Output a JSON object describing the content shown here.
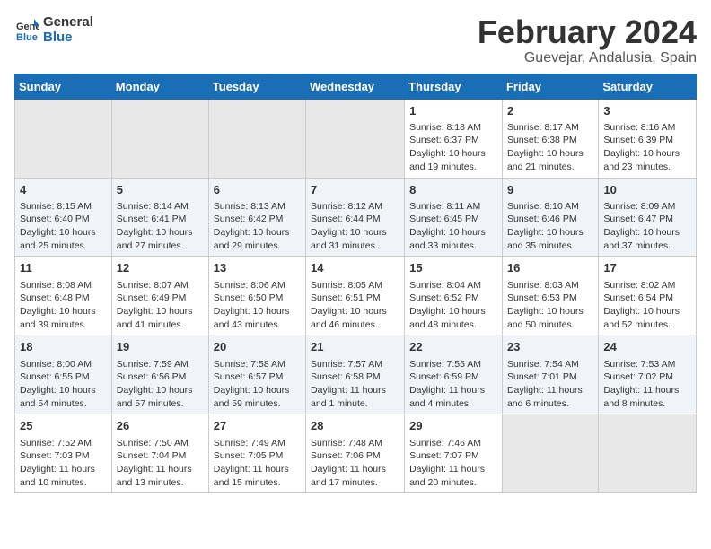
{
  "logo": {
    "line1": "General",
    "line2": "Blue"
  },
  "title": "February 2024",
  "subtitle": "Guevejar, Andalusia, Spain",
  "weekdays": [
    "Sunday",
    "Monday",
    "Tuesday",
    "Wednesday",
    "Thursday",
    "Friday",
    "Saturday"
  ],
  "weeks": [
    [
      {
        "day": "",
        "content": ""
      },
      {
        "day": "",
        "content": ""
      },
      {
        "day": "",
        "content": ""
      },
      {
        "day": "",
        "content": ""
      },
      {
        "day": "1",
        "content": "Sunrise: 8:18 AM\nSunset: 6:37 PM\nDaylight: 10 hours and 19 minutes."
      },
      {
        "day": "2",
        "content": "Sunrise: 8:17 AM\nSunset: 6:38 PM\nDaylight: 10 hours and 21 minutes."
      },
      {
        "day": "3",
        "content": "Sunrise: 8:16 AM\nSunset: 6:39 PM\nDaylight: 10 hours and 23 minutes."
      }
    ],
    [
      {
        "day": "4",
        "content": "Sunrise: 8:15 AM\nSunset: 6:40 PM\nDaylight: 10 hours and 25 minutes."
      },
      {
        "day": "5",
        "content": "Sunrise: 8:14 AM\nSunset: 6:41 PM\nDaylight: 10 hours and 27 minutes."
      },
      {
        "day": "6",
        "content": "Sunrise: 8:13 AM\nSunset: 6:42 PM\nDaylight: 10 hours and 29 minutes."
      },
      {
        "day": "7",
        "content": "Sunrise: 8:12 AM\nSunset: 6:44 PM\nDaylight: 10 hours and 31 minutes."
      },
      {
        "day": "8",
        "content": "Sunrise: 8:11 AM\nSunset: 6:45 PM\nDaylight: 10 hours and 33 minutes."
      },
      {
        "day": "9",
        "content": "Sunrise: 8:10 AM\nSunset: 6:46 PM\nDaylight: 10 hours and 35 minutes."
      },
      {
        "day": "10",
        "content": "Sunrise: 8:09 AM\nSunset: 6:47 PM\nDaylight: 10 hours and 37 minutes."
      }
    ],
    [
      {
        "day": "11",
        "content": "Sunrise: 8:08 AM\nSunset: 6:48 PM\nDaylight: 10 hours and 39 minutes."
      },
      {
        "day": "12",
        "content": "Sunrise: 8:07 AM\nSunset: 6:49 PM\nDaylight: 10 hours and 41 minutes."
      },
      {
        "day": "13",
        "content": "Sunrise: 8:06 AM\nSunset: 6:50 PM\nDaylight: 10 hours and 43 minutes."
      },
      {
        "day": "14",
        "content": "Sunrise: 8:05 AM\nSunset: 6:51 PM\nDaylight: 10 hours and 46 minutes."
      },
      {
        "day": "15",
        "content": "Sunrise: 8:04 AM\nSunset: 6:52 PM\nDaylight: 10 hours and 48 minutes."
      },
      {
        "day": "16",
        "content": "Sunrise: 8:03 AM\nSunset: 6:53 PM\nDaylight: 10 hours and 50 minutes."
      },
      {
        "day": "17",
        "content": "Sunrise: 8:02 AM\nSunset: 6:54 PM\nDaylight: 10 hours and 52 minutes."
      }
    ],
    [
      {
        "day": "18",
        "content": "Sunrise: 8:00 AM\nSunset: 6:55 PM\nDaylight: 10 hours and 54 minutes."
      },
      {
        "day": "19",
        "content": "Sunrise: 7:59 AM\nSunset: 6:56 PM\nDaylight: 10 hours and 57 minutes."
      },
      {
        "day": "20",
        "content": "Sunrise: 7:58 AM\nSunset: 6:57 PM\nDaylight: 10 hours and 59 minutes."
      },
      {
        "day": "21",
        "content": "Sunrise: 7:57 AM\nSunset: 6:58 PM\nDaylight: 11 hours and 1 minute."
      },
      {
        "day": "22",
        "content": "Sunrise: 7:55 AM\nSunset: 6:59 PM\nDaylight: 11 hours and 4 minutes."
      },
      {
        "day": "23",
        "content": "Sunrise: 7:54 AM\nSunset: 7:01 PM\nDaylight: 11 hours and 6 minutes."
      },
      {
        "day": "24",
        "content": "Sunrise: 7:53 AM\nSunset: 7:02 PM\nDaylight: 11 hours and 8 minutes."
      }
    ],
    [
      {
        "day": "25",
        "content": "Sunrise: 7:52 AM\nSunset: 7:03 PM\nDaylight: 11 hours and 10 minutes."
      },
      {
        "day": "26",
        "content": "Sunrise: 7:50 AM\nSunset: 7:04 PM\nDaylight: 11 hours and 13 minutes."
      },
      {
        "day": "27",
        "content": "Sunrise: 7:49 AM\nSunset: 7:05 PM\nDaylight: 11 hours and 15 minutes."
      },
      {
        "day": "28",
        "content": "Sunrise: 7:48 AM\nSunset: 7:06 PM\nDaylight: 11 hours and 17 minutes."
      },
      {
        "day": "29",
        "content": "Sunrise: 7:46 AM\nSunset: 7:07 PM\nDaylight: 11 hours and 20 minutes."
      },
      {
        "day": "",
        "content": ""
      },
      {
        "day": "",
        "content": ""
      }
    ]
  ]
}
